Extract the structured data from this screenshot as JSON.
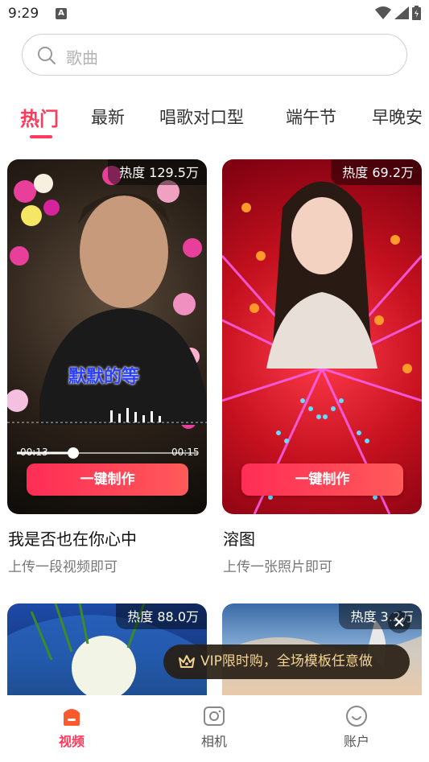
{
  "status": {
    "time": "9:29",
    "notif_glyph": "A"
  },
  "search": {
    "placeholder": "歌曲"
  },
  "tabs": [
    {
      "label": "热门",
      "active": true
    },
    {
      "label": "最新"
    },
    {
      "label": "唱歌对口型"
    },
    {
      "label": "端午节"
    },
    {
      "label": "早晚安"
    }
  ],
  "cards": [
    {
      "heat": "热度 129.5万",
      "title": "我是否也在你心中",
      "subtitle": "上传一段视频即可",
      "button": "一键制作",
      "caption": "默默的等",
      "time_start": "00:13",
      "time_end": "00:15"
    },
    {
      "heat": "热度 69.2万",
      "title": "溶图",
      "subtitle": "上传一张照片即可",
      "button": "一键制作"
    },
    {
      "heat": "热度 88.0万"
    },
    {
      "heat": "热度 3.2万"
    }
  ],
  "vip_toast": {
    "text": "VIP限时购，全场模板任意做"
  },
  "bottom_nav": [
    {
      "label": "视频",
      "icon": "home-icon",
      "active": true
    },
    {
      "label": "相机",
      "icon": "camera-icon"
    },
    {
      "label": "账户",
      "icon": "account-icon"
    }
  ],
  "colors": {
    "accent": "#ff3b5c",
    "vip_text": "#f2d394"
  }
}
